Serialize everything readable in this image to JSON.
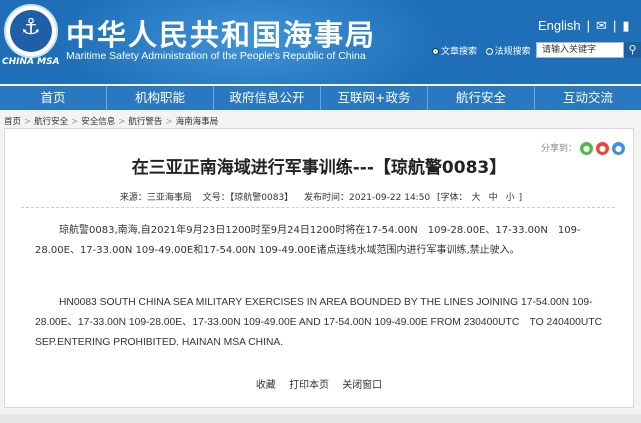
{
  "header": {
    "title_cn": "中华人民共和国海事局",
    "title_en": "Maritime Safety Administration of the People's Republic of China",
    "logo_text": "CHINA MSA",
    "english_link": "English",
    "sep": "|",
    "search_options": [
      "文章搜索",
      "法规搜索"
    ],
    "search_placeholder": "请输入关键字"
  },
  "nav": [
    "首页",
    "机构职能",
    "政府信息公开",
    "互联网+政务",
    "航行安全",
    "互动交流"
  ],
  "breadcrumb": [
    "首页",
    "航行安全",
    "安全信息",
    "航行警告",
    "海南海事局"
  ],
  "article": {
    "share_label": "分享到：",
    "title": "在三亚正南海域进行军事训练---【琼航警0083】",
    "source": "来源：三亚海事局",
    "doc_no": "文号：【琼航警0083】",
    "date": "发布时间：2021-09-22 14:50",
    "font_label": "[字体：",
    "font_sizes": [
      "大",
      "中",
      "小"
    ],
    "font_end": "]",
    "para_cn": "琼航警0083,南海,自2021年9月23日1200时至9月24日1200时将在17-54.00N　109-28.00E、17-33.00N　109-28.00E、17-33.00N 109-49.00E和17-54.00N 109-49.00E诸点连线水域范围内进行军事训练,禁止驶入。",
    "para_en": "HN0083 SOUTH CHINA SEA MILITARY EXERCISES IN AREA BOUNDED BY THE LINES JOINING 17-54.00N 109-28.00E、17-33.00N 109-28.00E、17-33.00N 109-49.00E AND 17-54.00N 109-49.00E FROM 230400UTC　TO 240400UTC SEP.ENTERING PROHIBITED. HAINAN MSA CHINA.",
    "actions": [
      "收藏",
      "打印本页",
      "关闭窗口"
    ]
  },
  "colors": {
    "header_bg": "#1e6fb8",
    "nav_bg": "#2a79c0",
    "share_wechat": "#52b848",
    "share_weibo": "#e8473a",
    "share_qq": "#3f8ee3"
  }
}
